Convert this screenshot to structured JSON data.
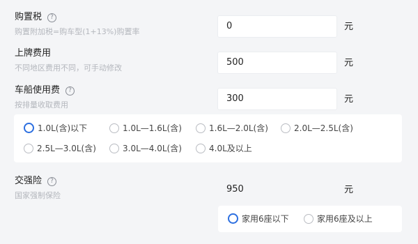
{
  "fields": {
    "purchase_tax": {
      "label": "购置税",
      "hint": "购置附加税=购车型(1+13%)购置率",
      "value": "0",
      "unit": "元"
    },
    "plate_fee": {
      "label": "上牌费用",
      "hint": "不同地区费用不同，可手动修改",
      "value": "500",
      "unit": "元"
    },
    "vehicle_vessel_tax": {
      "label": "车船使用费",
      "hint": "按排量收取费用",
      "value": "300",
      "unit": "元"
    },
    "compulsory_insurance": {
      "label": "交强险",
      "hint": "国家强制保险",
      "value": "950",
      "unit": "元"
    }
  },
  "help_icon": "?",
  "displacement_options": [
    {
      "label": "1.0L(含)以下",
      "selected": true
    },
    {
      "label": "1.0L—1.6L(含)",
      "selected": false
    },
    {
      "label": "1.6L—2.0L(含)",
      "selected": false
    },
    {
      "label": "2.0L—2.5L(含)",
      "selected": false
    },
    {
      "label": "2.5L—3.0L(含)",
      "selected": false
    },
    {
      "label": "3.0L—4.0L(含)",
      "selected": false
    },
    {
      "label": "4.0L及以上",
      "selected": false
    }
  ],
  "seat_options": [
    {
      "label": "家用6座以下",
      "selected": true
    },
    {
      "label": "家用6座及以上",
      "selected": false
    }
  ],
  "colors": {
    "accent": "#2c6fe0",
    "background": "#f4f5f7"
  }
}
